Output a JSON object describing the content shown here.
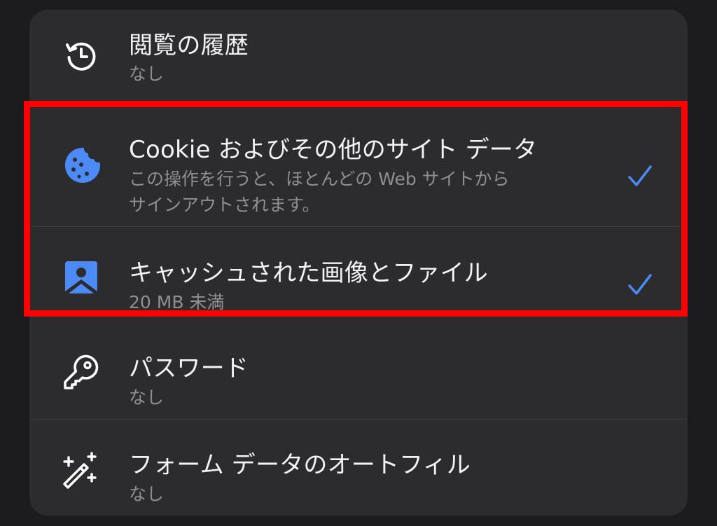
{
  "rows": [
    {
      "title": "閲覧の履歴",
      "sub": "なし",
      "icon": "history-icon"
    },
    {
      "title": "Cookie およびその他のサイト データ",
      "sub_line1": "この操作を行うと、ほとんどの Web サイトから",
      "sub_line2": "サインアウトされます。",
      "icon": "cookie-icon",
      "checked": true
    },
    {
      "title": "キャッシュされた画像とファイル",
      "sub": "20 MB 未満",
      "icon": "image-icon",
      "checked": true
    },
    {
      "title": "パスワード",
      "sub": "なし",
      "icon": "key-icon"
    },
    {
      "title": "フォーム データのオートフィル",
      "sub": "なし",
      "icon": "magic-wand-icon"
    }
  ],
  "colors": {
    "accent": "#4c8bf5",
    "highlight": "#ff0000",
    "card": "#2c2c2e",
    "background": "#1c1c1e"
  }
}
